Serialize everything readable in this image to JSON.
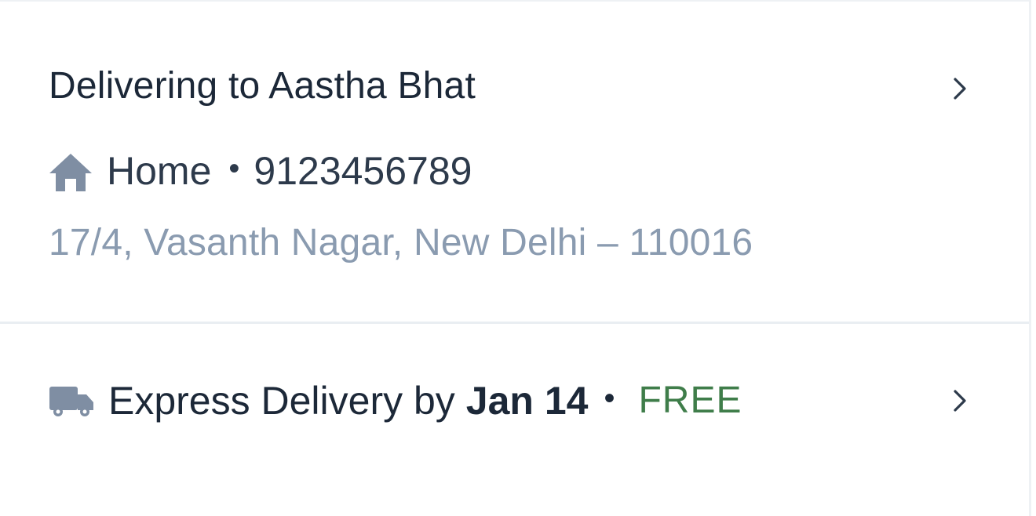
{
  "address": {
    "title": "Delivering to Aastha Bhat",
    "icon": "home-icon",
    "label": "Home",
    "separator": "•",
    "phone": "9123456789",
    "line": "17/4, Vasanth Nagar, New Delhi – 110016",
    "chevron": "chevron-right-icon"
  },
  "delivery": {
    "icon": "truck-icon",
    "text": "Express Delivery by",
    "date": "Jan 14",
    "separator": "•",
    "price": "FREE",
    "price_color": "#3f7d4a",
    "chevron": "chevron-right-icon"
  },
  "colors": {
    "primary_text": "#1c2838",
    "secondary_text": "#8a9bb0",
    "icon": "#7f8ea3",
    "divider": "#e9eef2"
  }
}
